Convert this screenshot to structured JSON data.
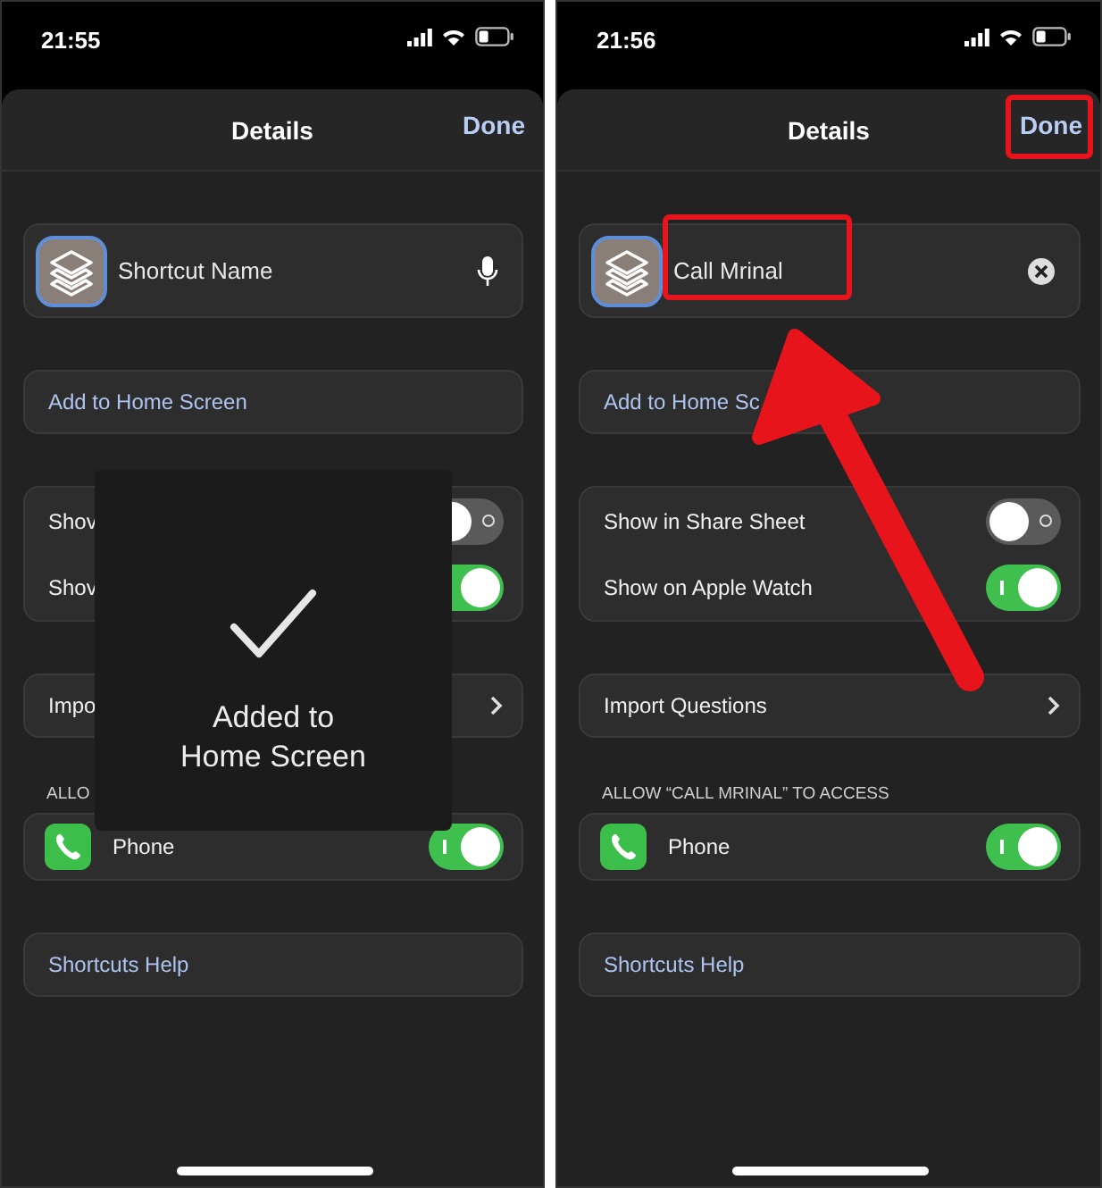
{
  "phones": [
    {
      "status_bar": {
        "time": "21:55"
      },
      "nav": {
        "title": "Details",
        "done": "Done"
      },
      "name_field": {
        "placeholder": "Shortcut Name"
      },
      "add_home": "Add to Home Screen",
      "toggles": [
        {
          "label": "Shov",
          "on": false
        },
        {
          "label": "Shov",
          "on": true
        }
      ],
      "import": "Impo",
      "section_header": "ALLO",
      "permission": {
        "label": "Phone",
        "on": true
      },
      "help": "Shortcuts Help",
      "hud": {
        "message": "Added to\nHome Screen"
      }
    },
    {
      "status_bar": {
        "time": "21:56"
      },
      "nav": {
        "title": "Details",
        "done": "Done"
      },
      "name_field": {
        "value": "Call Mrinal"
      },
      "add_home": "Add to Home Sc",
      "toggles": [
        {
          "label": "Show in Share Sheet",
          "on": false
        },
        {
          "label": "Show on Apple Watch",
          "on": true
        }
      ],
      "import": "Import Questions",
      "section_header": "ALLOW “CALL MRINAL” TO ACCESS",
      "permission": {
        "label": "Phone",
        "on": true
      },
      "help": "Shortcuts Help",
      "done_highlighted": true,
      "name_highlighted": true,
      "arrow": true
    }
  ]
}
